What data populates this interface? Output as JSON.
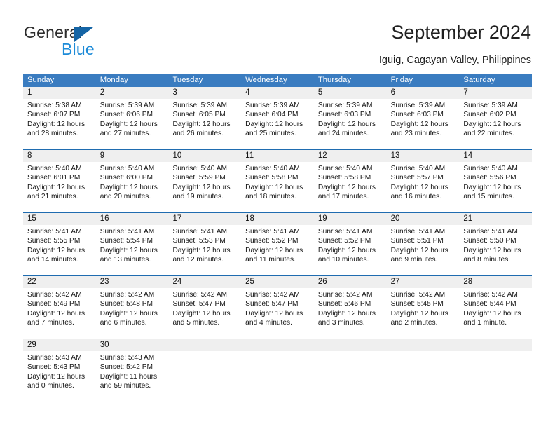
{
  "logo": {
    "word_top": "General",
    "word_bottom": "Blue",
    "triangle_color": "#1464a5",
    "blue_text_color": "#1d8bd8"
  },
  "header": {
    "title": "September 2024",
    "location": "Iguig, Cagayan Valley, Philippines"
  },
  "colors": {
    "header_bar": "#3a7cc0",
    "week_rule": "#1f6cb0",
    "daynum_band": "#efefef",
    "text": "#151515"
  },
  "weekdays": [
    "Sunday",
    "Monday",
    "Tuesday",
    "Wednesday",
    "Thursday",
    "Friday",
    "Saturday"
  ],
  "weeks": [
    {
      "days": [
        {
          "num": "1",
          "sunrise": "Sunrise: 5:38 AM",
          "sunset": "Sunset: 6:07 PM",
          "daylight1": "Daylight: 12 hours",
          "daylight2": "and 28 minutes."
        },
        {
          "num": "2",
          "sunrise": "Sunrise: 5:39 AM",
          "sunset": "Sunset: 6:06 PM",
          "daylight1": "Daylight: 12 hours",
          "daylight2": "and 27 minutes."
        },
        {
          "num": "3",
          "sunrise": "Sunrise: 5:39 AM",
          "sunset": "Sunset: 6:05 PM",
          "daylight1": "Daylight: 12 hours",
          "daylight2": "and 26 minutes."
        },
        {
          "num": "4",
          "sunrise": "Sunrise: 5:39 AM",
          "sunset": "Sunset: 6:04 PM",
          "daylight1": "Daylight: 12 hours",
          "daylight2": "and 25 minutes."
        },
        {
          "num": "5",
          "sunrise": "Sunrise: 5:39 AM",
          "sunset": "Sunset: 6:03 PM",
          "daylight1": "Daylight: 12 hours",
          "daylight2": "and 24 minutes."
        },
        {
          "num": "6",
          "sunrise": "Sunrise: 5:39 AM",
          "sunset": "Sunset: 6:03 PM",
          "daylight1": "Daylight: 12 hours",
          "daylight2": "and 23 minutes."
        },
        {
          "num": "7",
          "sunrise": "Sunrise: 5:39 AM",
          "sunset": "Sunset: 6:02 PM",
          "daylight1": "Daylight: 12 hours",
          "daylight2": "and 22 minutes."
        }
      ]
    },
    {
      "days": [
        {
          "num": "8",
          "sunrise": "Sunrise: 5:40 AM",
          "sunset": "Sunset: 6:01 PM",
          "daylight1": "Daylight: 12 hours",
          "daylight2": "and 21 minutes."
        },
        {
          "num": "9",
          "sunrise": "Sunrise: 5:40 AM",
          "sunset": "Sunset: 6:00 PM",
          "daylight1": "Daylight: 12 hours",
          "daylight2": "and 20 minutes."
        },
        {
          "num": "10",
          "sunrise": "Sunrise: 5:40 AM",
          "sunset": "Sunset: 5:59 PM",
          "daylight1": "Daylight: 12 hours",
          "daylight2": "and 19 minutes."
        },
        {
          "num": "11",
          "sunrise": "Sunrise: 5:40 AM",
          "sunset": "Sunset: 5:58 PM",
          "daylight1": "Daylight: 12 hours",
          "daylight2": "and 18 minutes."
        },
        {
          "num": "12",
          "sunrise": "Sunrise: 5:40 AM",
          "sunset": "Sunset: 5:58 PM",
          "daylight1": "Daylight: 12 hours",
          "daylight2": "and 17 minutes."
        },
        {
          "num": "13",
          "sunrise": "Sunrise: 5:40 AM",
          "sunset": "Sunset: 5:57 PM",
          "daylight1": "Daylight: 12 hours",
          "daylight2": "and 16 minutes."
        },
        {
          "num": "14",
          "sunrise": "Sunrise: 5:40 AM",
          "sunset": "Sunset: 5:56 PM",
          "daylight1": "Daylight: 12 hours",
          "daylight2": "and 15 minutes."
        }
      ]
    },
    {
      "days": [
        {
          "num": "15",
          "sunrise": "Sunrise: 5:41 AM",
          "sunset": "Sunset: 5:55 PM",
          "daylight1": "Daylight: 12 hours",
          "daylight2": "and 14 minutes."
        },
        {
          "num": "16",
          "sunrise": "Sunrise: 5:41 AM",
          "sunset": "Sunset: 5:54 PM",
          "daylight1": "Daylight: 12 hours",
          "daylight2": "and 13 minutes."
        },
        {
          "num": "17",
          "sunrise": "Sunrise: 5:41 AM",
          "sunset": "Sunset: 5:53 PM",
          "daylight1": "Daylight: 12 hours",
          "daylight2": "and 12 minutes."
        },
        {
          "num": "18",
          "sunrise": "Sunrise: 5:41 AM",
          "sunset": "Sunset: 5:52 PM",
          "daylight1": "Daylight: 12 hours",
          "daylight2": "and 11 minutes."
        },
        {
          "num": "19",
          "sunrise": "Sunrise: 5:41 AM",
          "sunset": "Sunset: 5:52 PM",
          "daylight1": "Daylight: 12 hours",
          "daylight2": "and 10 minutes."
        },
        {
          "num": "20",
          "sunrise": "Sunrise: 5:41 AM",
          "sunset": "Sunset: 5:51 PM",
          "daylight1": "Daylight: 12 hours",
          "daylight2": "and 9 minutes."
        },
        {
          "num": "21",
          "sunrise": "Sunrise: 5:41 AM",
          "sunset": "Sunset: 5:50 PM",
          "daylight1": "Daylight: 12 hours",
          "daylight2": "and 8 minutes."
        }
      ]
    },
    {
      "days": [
        {
          "num": "22",
          "sunrise": "Sunrise: 5:42 AM",
          "sunset": "Sunset: 5:49 PM",
          "daylight1": "Daylight: 12 hours",
          "daylight2": "and 7 minutes."
        },
        {
          "num": "23",
          "sunrise": "Sunrise: 5:42 AM",
          "sunset": "Sunset: 5:48 PM",
          "daylight1": "Daylight: 12 hours",
          "daylight2": "and 6 minutes."
        },
        {
          "num": "24",
          "sunrise": "Sunrise: 5:42 AM",
          "sunset": "Sunset: 5:47 PM",
          "daylight1": "Daylight: 12 hours",
          "daylight2": "and 5 minutes."
        },
        {
          "num": "25",
          "sunrise": "Sunrise: 5:42 AM",
          "sunset": "Sunset: 5:47 PM",
          "daylight1": "Daylight: 12 hours",
          "daylight2": "and 4 minutes."
        },
        {
          "num": "26",
          "sunrise": "Sunrise: 5:42 AM",
          "sunset": "Sunset: 5:46 PM",
          "daylight1": "Daylight: 12 hours",
          "daylight2": "and 3 minutes."
        },
        {
          "num": "27",
          "sunrise": "Sunrise: 5:42 AM",
          "sunset": "Sunset: 5:45 PM",
          "daylight1": "Daylight: 12 hours",
          "daylight2": "and 2 minutes."
        },
        {
          "num": "28",
          "sunrise": "Sunrise: 5:42 AM",
          "sunset": "Sunset: 5:44 PM",
          "daylight1": "Daylight: 12 hours",
          "daylight2": "and 1 minute."
        }
      ]
    },
    {
      "days": [
        {
          "num": "29",
          "sunrise": "Sunrise: 5:43 AM",
          "sunset": "Sunset: 5:43 PM",
          "daylight1": "Daylight: 12 hours",
          "daylight2": "and 0 minutes."
        },
        {
          "num": "30",
          "sunrise": "Sunrise: 5:43 AM",
          "sunset": "Sunset: 5:42 PM",
          "daylight1": "Daylight: 11 hours",
          "daylight2": "and 59 minutes."
        },
        {
          "num": "",
          "sunrise": "",
          "sunset": "",
          "daylight1": "",
          "daylight2": ""
        },
        {
          "num": "",
          "sunrise": "",
          "sunset": "",
          "daylight1": "",
          "daylight2": ""
        },
        {
          "num": "",
          "sunrise": "",
          "sunset": "",
          "daylight1": "",
          "daylight2": ""
        },
        {
          "num": "",
          "sunrise": "",
          "sunset": "",
          "daylight1": "",
          "daylight2": ""
        },
        {
          "num": "",
          "sunrise": "",
          "sunset": "",
          "daylight1": "",
          "daylight2": ""
        }
      ]
    }
  ]
}
